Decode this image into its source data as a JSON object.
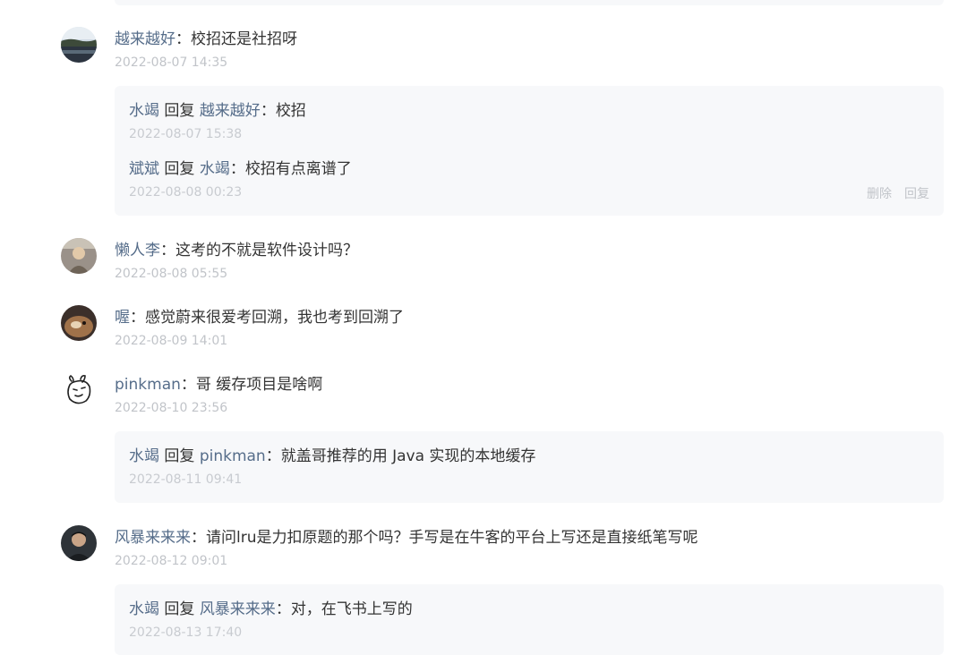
{
  "comments": [
    {
      "user": "越来越好",
      "text": "校招还是社招呀",
      "time": "2022-08-07 14:35",
      "replies": [
        {
          "user": "水竭",
          "verb": "回复",
          "target": "越来越好",
          "text": "校招",
          "time": "2022-08-07 15:38"
        },
        {
          "user": "斌斌",
          "verb": "回复",
          "target": "水竭",
          "text": "校招有点离谱了",
          "time": "2022-08-08 00:23",
          "actions": [
            "删除",
            "回复"
          ]
        }
      ]
    },
    {
      "user": "懒人李",
      "text": "这考的不就是软件设计吗？",
      "time": "2022-08-08 05:55"
    },
    {
      "user": "喔",
      "text": "感觉蔚来很爱考回溯，我也考到回溯了",
      "time": "2022-08-09 14:01"
    },
    {
      "user": "pinkman",
      "text": "哥 缓存项目是啥啊",
      "time": "2022-08-10 23:56",
      "replies": [
        {
          "user": "水竭",
          "verb": "回复",
          "target": "pinkman",
          "text": "就盖哥推荐的用 Java 实现的本地缓存",
          "time": "2022-08-11 09:41"
        }
      ]
    },
    {
      "user": "风暴来来来",
      "text": "请问lru是力扣原题的那个吗？手写是在牛客的平台上写还是直接纸笔写呢",
      "time": "2022-08-12 09:01",
      "replies": [
        {
          "user": "水竭",
          "verb": "回复",
          "target": "风暴来来来",
          "text": "对，在飞书上写的",
          "time": "2022-08-13 17:40"
        }
      ]
    }
  ],
  "colon": "："
}
